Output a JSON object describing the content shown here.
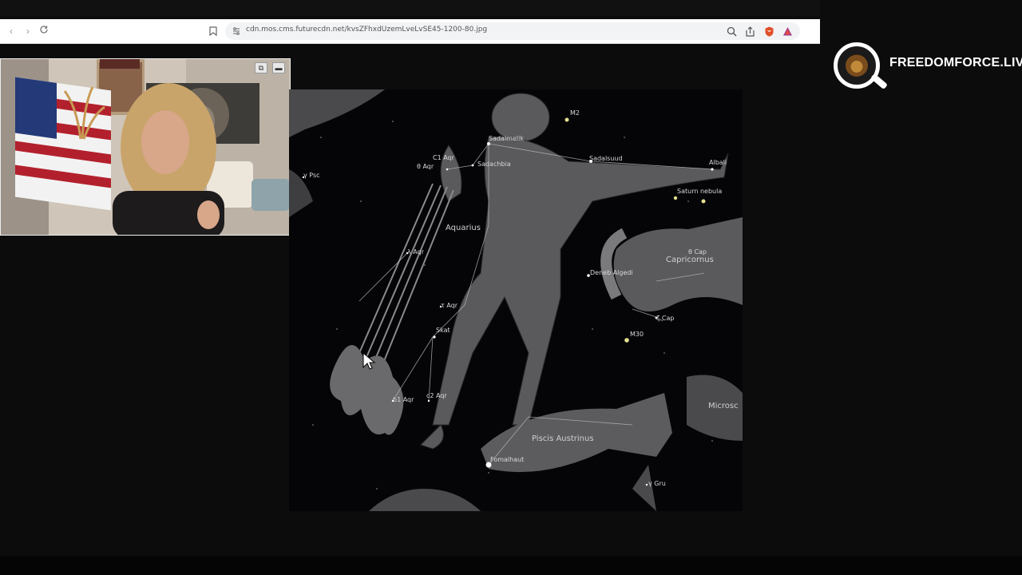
{
  "browser": {
    "url": "cdn.mos.cms.futurecdn.net/kvsZFhxdUzemLveLvSE45-1200-80.jpg",
    "icons": [
      "back-icon",
      "forward-icon",
      "reload-icon",
      "bookmark-icon",
      "site-info-icon",
      "zoom-icon",
      "share-icon",
      "brave-shield-icon",
      "brave-rewards-icon"
    ]
  },
  "webcam": {
    "controls": [
      "popout-icon",
      "minimize-icon"
    ]
  },
  "logo": {
    "text": "FREEDOMFORCE.LIVE",
    "colors": {
      "ring": "#ffffff",
      "text": "#ffffff"
    }
  },
  "chart": {
    "constellations": [
      {
        "name": "Aquarius"
      },
      {
        "name": "Capricornus"
      },
      {
        "name": "Piscis Austrinus"
      },
      {
        "name": "Microsc"
      }
    ],
    "stars": [
      {
        "name": "M2"
      },
      {
        "name": "Sadalmelik"
      },
      {
        "name": "Sadalsuud"
      },
      {
        "name": "Albali"
      },
      {
        "name": "Saturn nebula"
      },
      {
        "name": "Sadachbia"
      },
      {
        "name": "C1 Aqr"
      },
      {
        "name": "θ Aqr"
      },
      {
        "name": "γ Psc"
      },
      {
        "name": "λ Aqr"
      },
      {
        "name": "τ Aqr"
      },
      {
        "name": "Skat"
      },
      {
        "name": "b1 Aqr"
      },
      {
        "name": "c2 Aqr"
      },
      {
        "name": "Deneb Algedi"
      },
      {
        "name": "θ Cap"
      },
      {
        "name": "ζ Cap"
      },
      {
        "name": "M30"
      },
      {
        "name": "Fomalhaut"
      },
      {
        "name": "γ Gru"
      }
    ]
  }
}
